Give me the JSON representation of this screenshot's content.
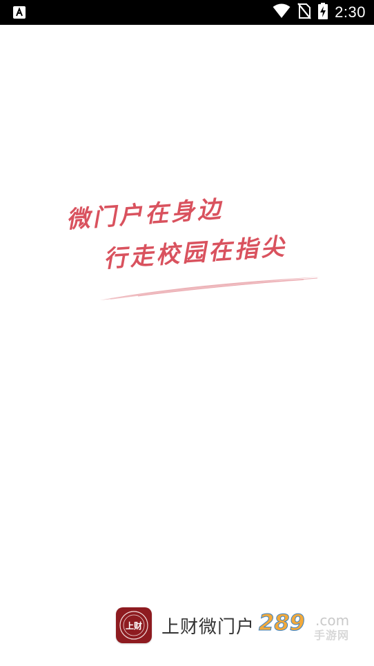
{
  "status_bar": {
    "time": "2:30",
    "icons": [
      "app-notification-icon",
      "wifi-icon",
      "no-sim-icon",
      "battery-charging-icon"
    ]
  },
  "splash": {
    "slogan_line1": "微门户在身边",
    "slogan_line2": "行走校园在指尖",
    "slogan_color": "#d9525e",
    "brand": {
      "logo_text": "上财",
      "logo_color": "#8e1b20",
      "app_name": "上财微门户"
    },
    "watermark": {
      "number": "289",
      "domain": ".com",
      "subtitle": "手游网"
    }
  }
}
